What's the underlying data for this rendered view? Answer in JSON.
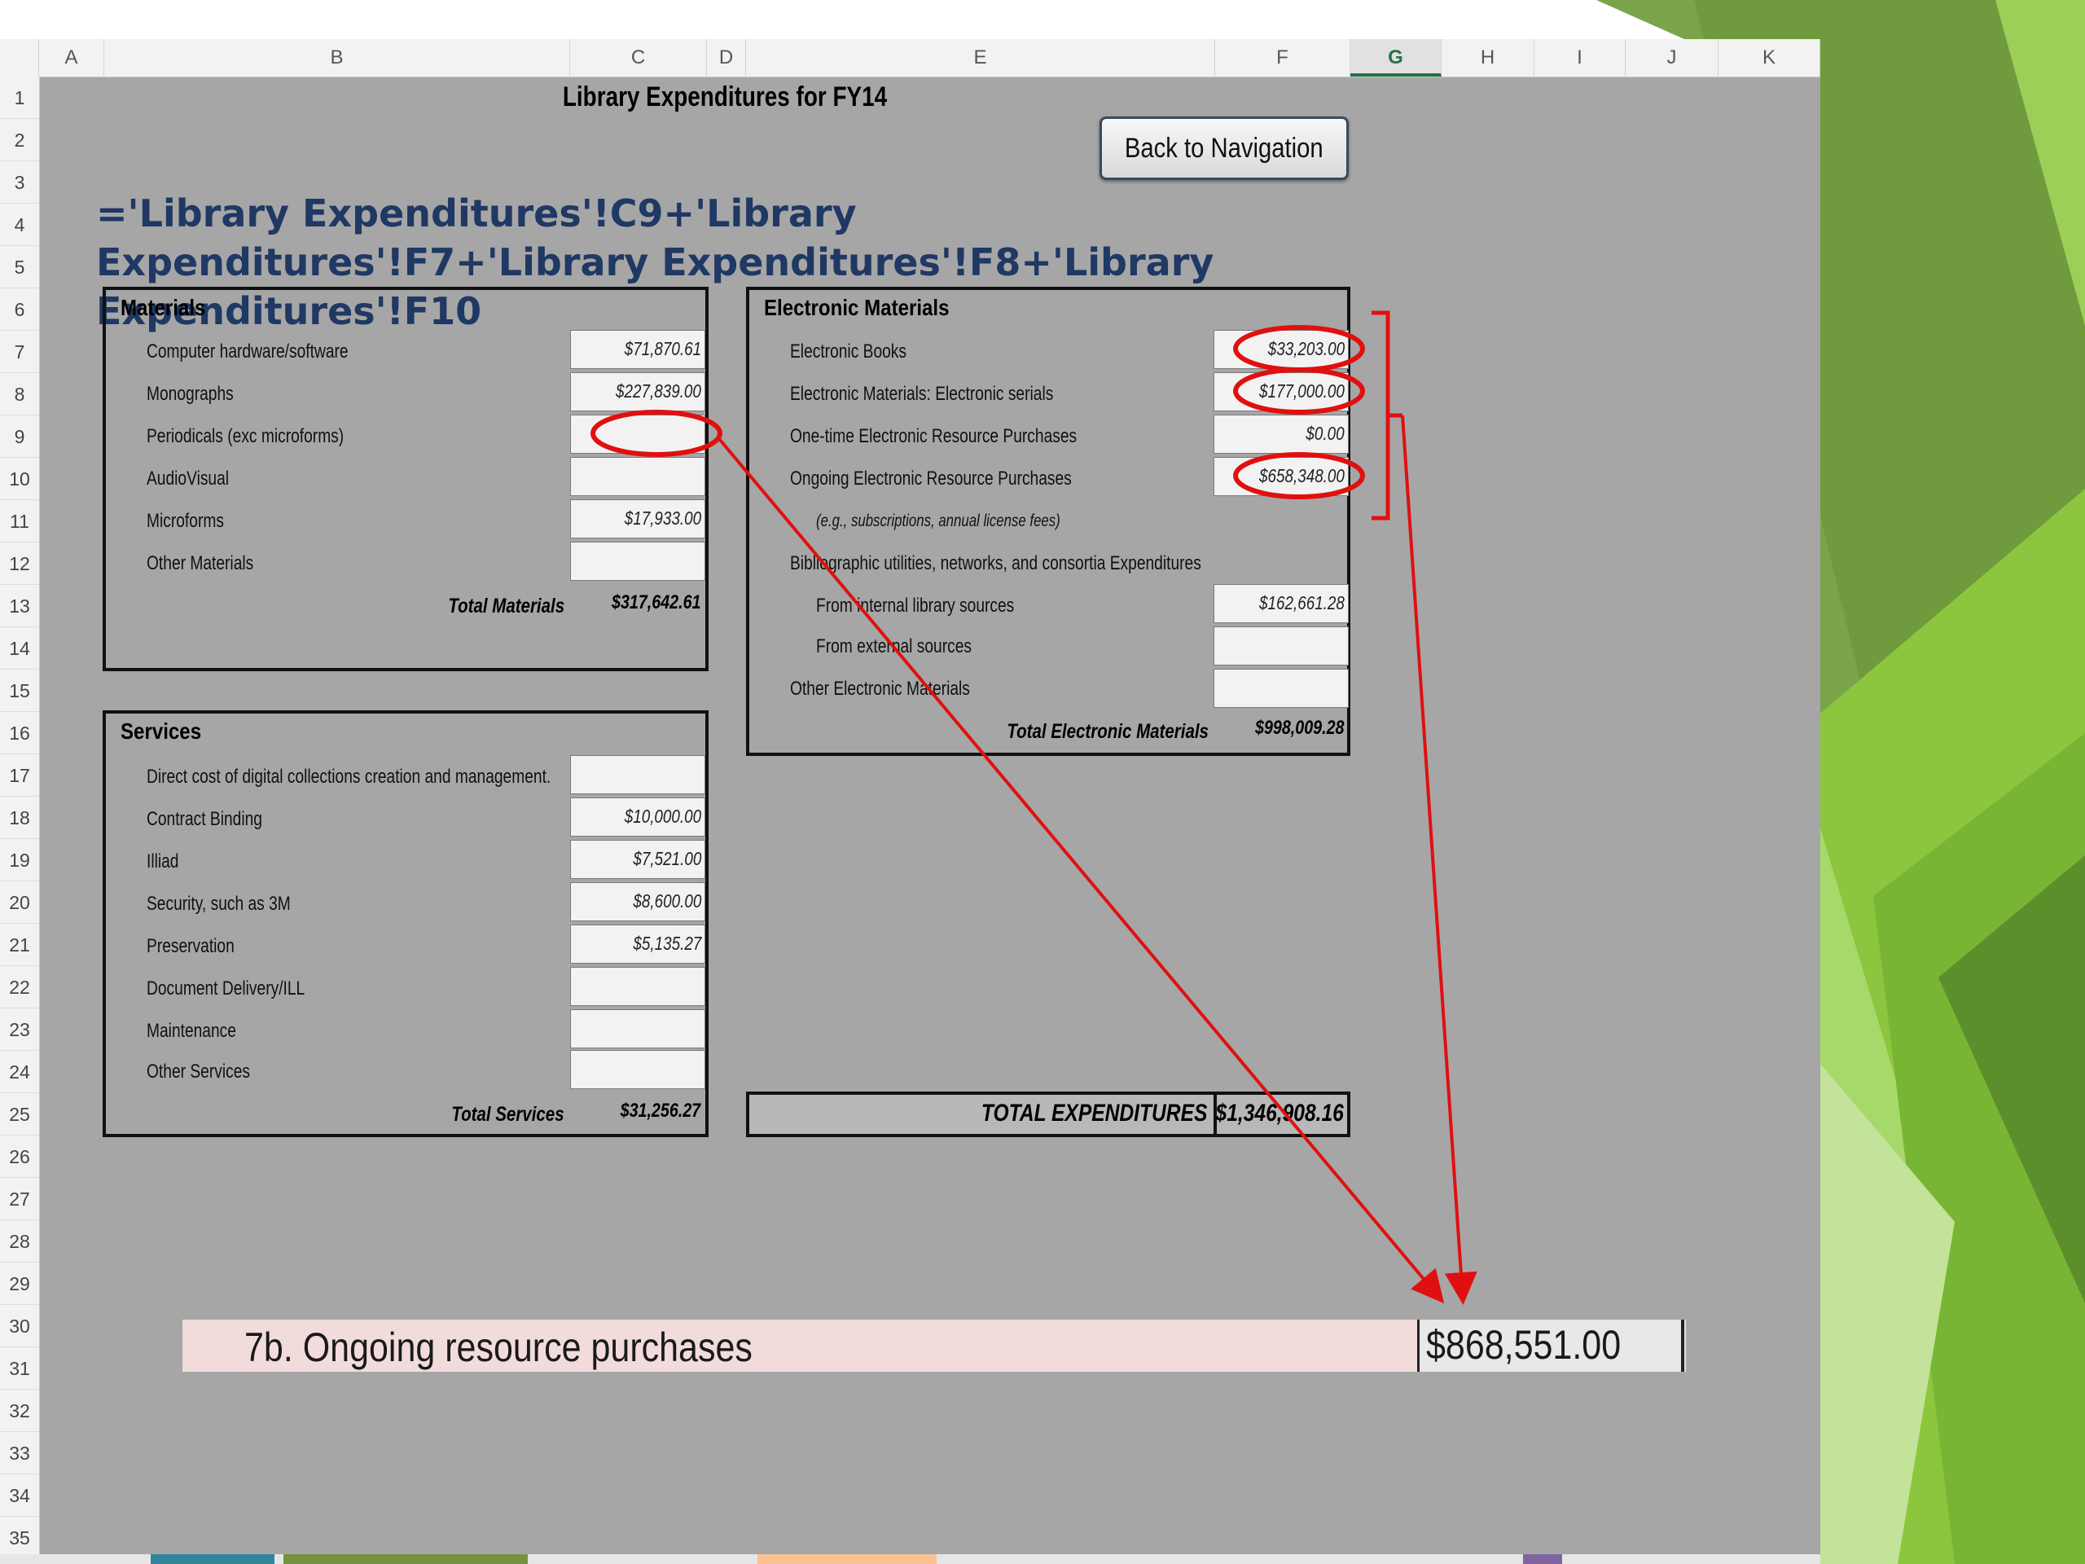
{
  "sheet": {
    "columns": [
      "A",
      "B",
      "C",
      "D",
      "E",
      "F",
      "G",
      "H",
      "I",
      "J",
      "K"
    ],
    "selected_column": "G",
    "rows": [
      "1",
      "2",
      "3",
      "4",
      "5",
      "6",
      "7",
      "8",
      "9",
      "10",
      "11",
      "12",
      "13",
      "14",
      "15",
      "16",
      "17",
      "18",
      "19",
      "20",
      "21",
      "22",
      "23",
      "24",
      "25",
      "26",
      "27",
      "28",
      "29",
      "30",
      "31",
      "32",
      "33",
      "34",
      "35"
    ]
  },
  "title": "Library Expenditures for FY14",
  "nav_button": "Back to Navigation",
  "formula": "='Library Expenditures'!C9+'Library Expenditures'!F7+'Library Expenditures'!F8+'Library Expenditures'!F10",
  "materials": {
    "title": "Materials",
    "items": [
      {
        "label": "Computer hardware/software",
        "value": "$71,870.61"
      },
      {
        "label": "Monographs",
        "value": "$227,839.00"
      },
      {
        "label": "Periodicals (exc microforms)",
        "value": ""
      },
      {
        "label": "AudioVisual",
        "value": ""
      },
      {
        "label": "Microforms",
        "value": "$17,933.00"
      },
      {
        "label": "Other Materials",
        "value": ""
      }
    ],
    "total_label": "Total Materials",
    "total_value": "$317,642.61"
  },
  "services": {
    "title": "Services",
    "items": [
      {
        "label": "Direct cost of digital collections creation and management.",
        "value": ""
      },
      {
        "label": "Contract Binding",
        "value": "$10,000.00"
      },
      {
        "label": "Illiad",
        "value": "$7,521.00"
      },
      {
        "label": "Security, such as 3M",
        "value": "$8,600.00"
      },
      {
        "label": "Preservation",
        "value": "$5,135.27"
      },
      {
        "label": "Document Delivery/ILL",
        "value": ""
      },
      {
        "label": "Maintenance",
        "value": ""
      },
      {
        "label": "Other Services",
        "value": ""
      }
    ],
    "total_label": "Total Services",
    "total_value": "$31,256.27"
  },
  "electronic": {
    "title": "Electronic Materials",
    "items": [
      {
        "label": "Electronic Books",
        "value": "$33,203.00"
      },
      {
        "label": "Electronic Materials: Electronic serials",
        "value": "$177,000.00"
      },
      {
        "label": "One-time Electronic Resource Purchases",
        "value": "$0.00"
      },
      {
        "label": "Ongoing Electronic Resource Purchases",
        "value": "$658,348.00"
      }
    ],
    "note": "(e.g., subscriptions, annual license fees)",
    "bib_label": "Bibliographic utilities, networks, and consortia Expenditures",
    "sub_items": [
      {
        "label": "From internal library sources",
        "value": "$162,661.28"
      },
      {
        "label": "From external sources",
        "value": ""
      }
    ],
    "other": {
      "label": "Other Electronic Materials",
      "value": ""
    },
    "total_label": "Total Electronic Materials",
    "total_value": "$998,009.28"
  },
  "grand_total": {
    "label": "TOTAL EXPENDITURES",
    "value": "$1,346,908.16"
  },
  "result": {
    "label": "7b. Ongoing resource purchases",
    "value": "$868,551.00"
  },
  "colors": {
    "sheet_bg": "#a6a6a6",
    "formula_text": "#1f3864",
    "annotation_red": "#e01010",
    "result_row_bg": "#f2dcdb",
    "green_accent": "#8cc63f"
  }
}
